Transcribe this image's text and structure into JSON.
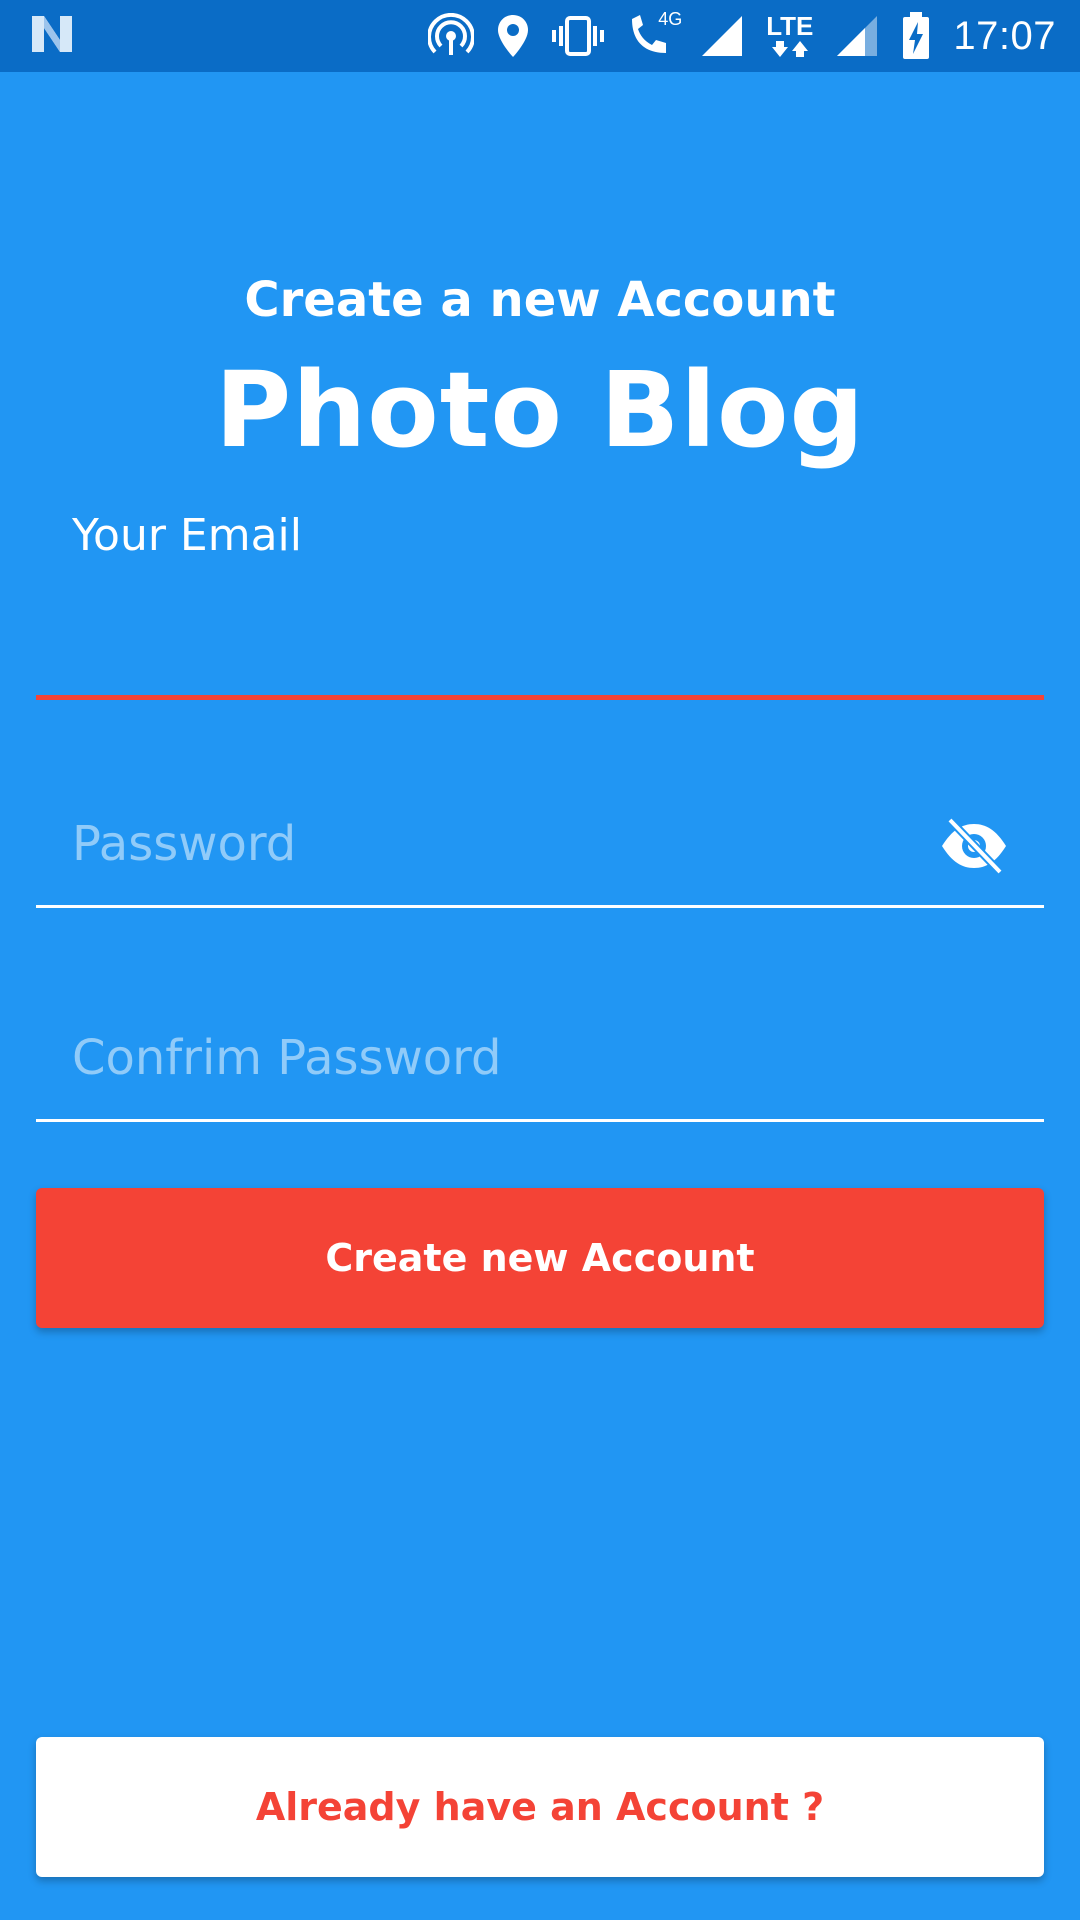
{
  "status_bar": {
    "time": "17:07",
    "network_4g": "4G",
    "network_lte": "LTE",
    "icons": [
      "app-n-icon",
      "hotspot-icon",
      "location-icon",
      "vibrate-icon",
      "wifi-call-icon",
      "signal-icon",
      "lte-icon",
      "signal-icon",
      "battery-charging-icon"
    ]
  },
  "header": {
    "subtitle": "Create a new Account",
    "title": "Photo Blog"
  },
  "form": {
    "email_label": "Your Email",
    "email_value": "",
    "password_placeholder": "Password",
    "confirm_password_placeholder": "Confrim Password"
  },
  "actions": {
    "create_label": "Create new Account",
    "login_label": "Already have an Account ?"
  },
  "colors": {
    "background": "#2196F3",
    "status_bar": "#0A6CC6",
    "accent": "#F44336",
    "white": "#FFFFFF"
  }
}
